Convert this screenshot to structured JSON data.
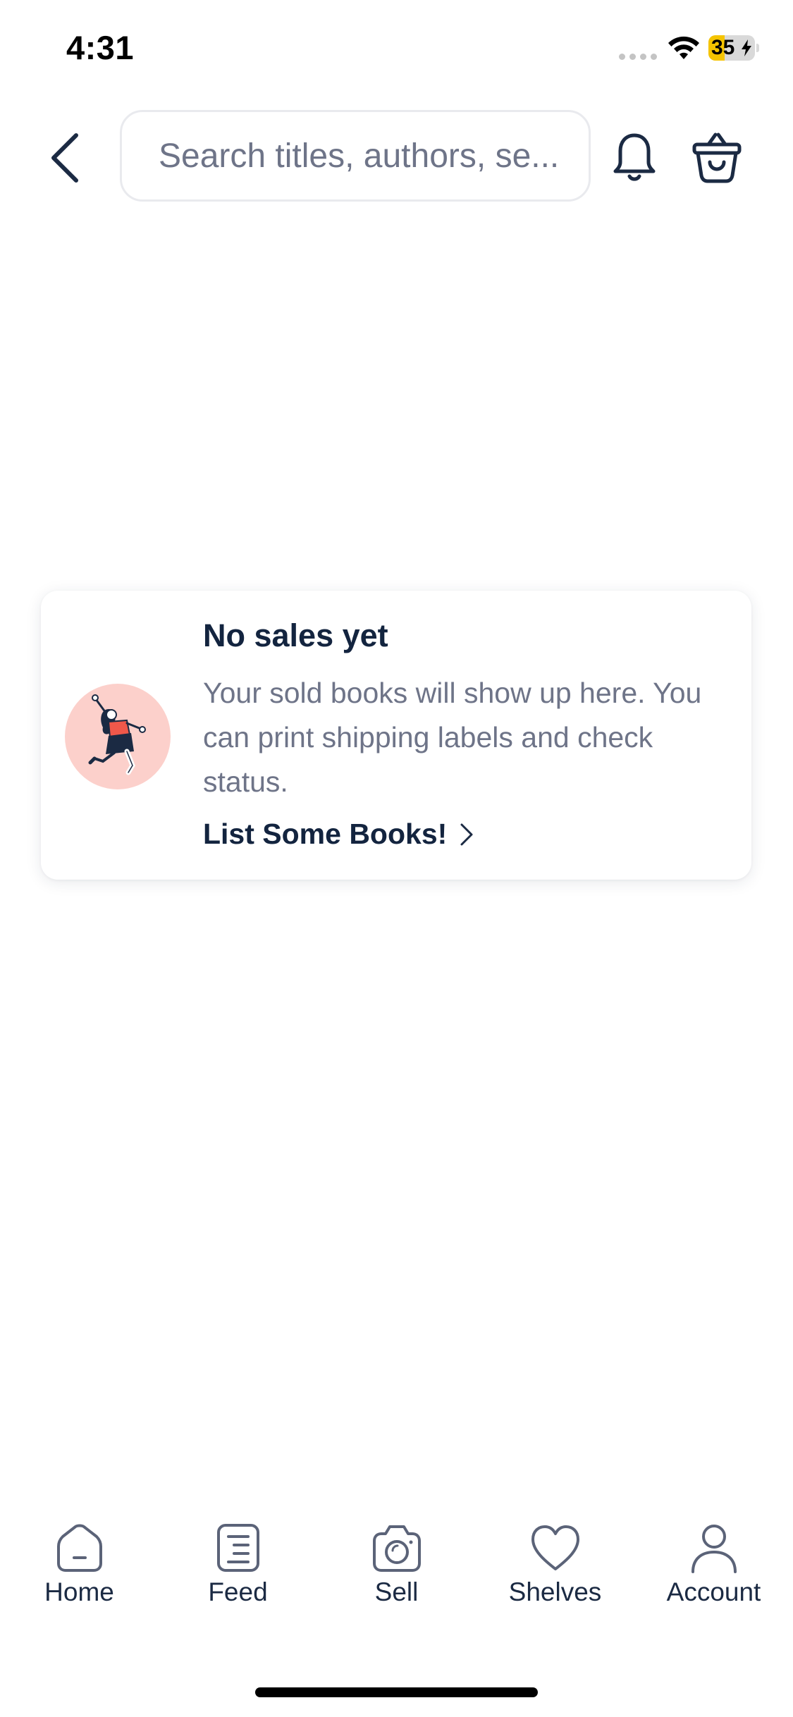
{
  "status_bar": {
    "time": "4:31",
    "battery_level": "35",
    "battery_percent": 35,
    "battery_fill_color": "#f5c400",
    "charging": true,
    "icons": [
      "signal-dots-icon",
      "wifi-icon",
      "battery-icon",
      "charging-bolt-icon"
    ]
  },
  "header": {
    "back_icon": "chevron-left-icon",
    "search": {
      "placeholder": "Search titles, authors, se...",
      "value": ""
    },
    "notifications_icon": "bell-icon",
    "cart_icon": "basket-icon"
  },
  "empty_state": {
    "illustration": "jumping-woman-illustration",
    "title": "No sales yet",
    "body": "Your sold books will show up here. You can print shipping labels and check status.",
    "link_label": "List Some Books!",
    "link_icon": "chevron-right-icon"
  },
  "tab_bar": {
    "tabs": [
      {
        "label": "Home",
        "icon": "home-icon"
      },
      {
        "label": "Feed",
        "icon": "feed-icon"
      },
      {
        "label": "Sell",
        "icon": "camera-icon"
      },
      {
        "label": "Shelves",
        "icon": "heart-icon"
      },
      {
        "label": "Account",
        "icon": "user-icon"
      }
    ]
  },
  "colors": {
    "primary_text": "#13243f",
    "secondary_text": "#6e7488",
    "icon": "#1b2a43",
    "tab_icon": "#5b6378",
    "illustration_bg": "#fcd0cb",
    "illustration_accent": "#f0584a"
  }
}
